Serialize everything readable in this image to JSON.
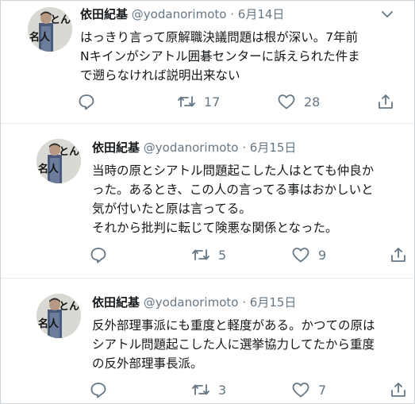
{
  "tweets": [
    {
      "name": "依田紀基",
      "handle": "@yodanorimoto",
      "separator": "·",
      "date": "6月14日",
      "lines": [
        "はっきり言って原解職決議問題は根が深い。7年前",
        "Nキインがシアトル囲碁センターに訴えられた件ま",
        "で遡らなければ説明出来ない"
      ],
      "retweets": "17",
      "likes": "28",
      "avatar_text": [
        "とん",
        "名人"
      ]
    },
    {
      "name": "依田紀基",
      "handle": "@yodanorimoto",
      "separator": "·",
      "date": "6月15日",
      "lines": [
        "当時の原とシアトル問題起こした人はとても仲良か",
        "った。あるとき、この人の言ってる事はおかしいと",
        "気が付いたと原は言ってる。",
        "それから批判に転じて険悪な関係となった。"
      ],
      "retweets": "5",
      "likes": "9",
      "avatar_text": [
        "とん",
        "名人"
      ]
    },
    {
      "name": "依田紀基",
      "handle": "@yodanorimoto",
      "separator": "·",
      "date": "6月15日",
      "lines": [
        "反外部理事派にも重度と軽度がある。かつての原は",
        "シアトル問題起こした人に選挙協力してたから重度",
        "の反外部理事長派。"
      ],
      "retweets": "3",
      "likes": "7",
      "avatar_text": [
        "とん",
        "名人"
      ]
    }
  ],
  "icons": {
    "reply": "reply-icon",
    "retweet": "retweet-icon",
    "like": "heart-icon",
    "share": "share-icon",
    "more": "chevron-down-icon"
  },
  "colors": {
    "text": "#14171a",
    "muted": "#657786",
    "divider": "#e6ecf0"
  }
}
